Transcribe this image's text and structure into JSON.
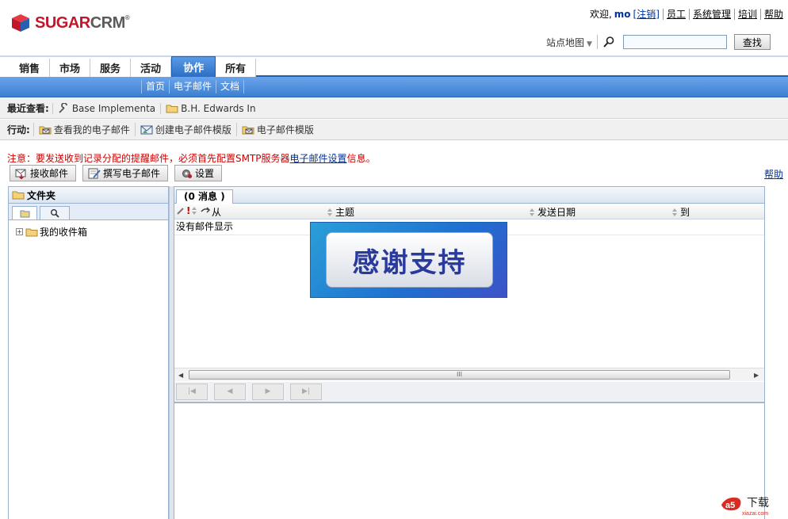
{
  "header": {
    "logo_text_sugar": "SUGAR",
    "logo_text_crm": "CRM",
    "logo_reg": "®",
    "welcome": "欢迎,",
    "username": "mo",
    "logout": "注销",
    "links": [
      "员工",
      "系统管理",
      "培训",
      "帮助"
    ],
    "sitemap": "站点地图",
    "search_value": "",
    "search_button": "查找"
  },
  "tabs": [
    {
      "label": "销售",
      "active": false
    },
    {
      "label": "市场",
      "active": false
    },
    {
      "label": "服务",
      "active": false
    },
    {
      "label": "活动",
      "active": false
    },
    {
      "label": "协作",
      "active": true
    },
    {
      "label": "所有",
      "active": false
    }
  ],
  "subnav": [
    "首页",
    "电子邮件",
    "文档"
  ],
  "recent": {
    "label": "最近查看:",
    "items": [
      "Base Implementa",
      "B.H. Edwards In"
    ]
  },
  "actions": {
    "label": "行动:",
    "items": [
      "查看我的电子邮件",
      "创建电子邮件模版",
      "电子邮件模版"
    ]
  },
  "notice": {
    "prefix": "注意：要发送收到记录分配的提醒邮件，必须首先配置SMTP服务器",
    "link": "电子邮件设置",
    "suffix": "信息。"
  },
  "toolbar": {
    "receive": "接收邮件",
    "compose": "撰写电子邮件",
    "settings": "设置",
    "help": "帮助"
  },
  "folders": {
    "title": "文件夹",
    "inbox": "我的收件箱"
  },
  "messages": {
    "tab_label": "(0 消息 )",
    "columns": {
      "from": "从",
      "subject": "主题",
      "date": "发送日期",
      "to": "到"
    },
    "empty_text": "没有邮件显示",
    "scroll_grip": "III"
  },
  "overlay": {
    "text": "感谢支持"
  },
  "watermark": {
    "main": "下载",
    "site": "xiazai.com"
  },
  "colors": {
    "brand_red": "#c0172b",
    "tab_blue": "#2b6ec4",
    "notice_red": "#cc0000",
    "link_blue": "#003399"
  }
}
